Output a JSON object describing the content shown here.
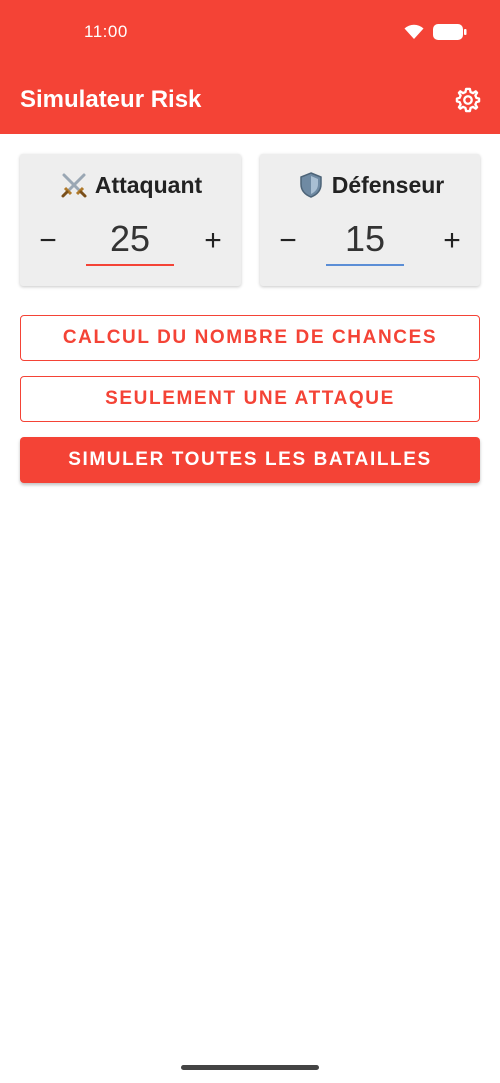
{
  "status_bar": {
    "time": "11:00"
  },
  "app_bar": {
    "title": "Simulateur Risk",
    "settings_icon": "gear-icon"
  },
  "colors": {
    "accent": "#f44336",
    "defense_underline": "#5b8ed6",
    "card_bg": "#eeeeee"
  },
  "attacker": {
    "icon": "crossed-swords-icon",
    "label": "Attaquant",
    "minus": "−",
    "value": "25",
    "plus": "+"
  },
  "defender": {
    "icon": "shield-icon",
    "label": "Défenseur",
    "minus": "−",
    "value": "15",
    "plus": "+"
  },
  "buttons": {
    "chances": "CALCUL DU NOMBRE DE CHANCES",
    "single_attack": "SEULEMENT UNE ATTAQUE",
    "simulate_all": "SIMULER TOUTES LES BATAILLES"
  }
}
